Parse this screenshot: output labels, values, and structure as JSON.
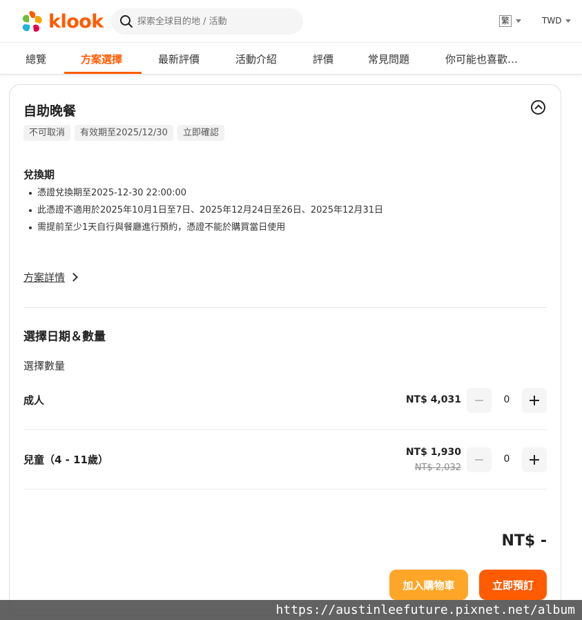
{
  "header": {
    "logo_text": "klook",
    "search_placeholder": "探索全球目的地 / 活動",
    "language": "繁",
    "currency": "TWD"
  },
  "tabs": [
    {
      "label": "總覽"
    },
    {
      "label": "方案選擇"
    },
    {
      "label": "最新評價"
    },
    {
      "label": "活動介紹"
    },
    {
      "label": "評價"
    },
    {
      "label": "常見問題"
    },
    {
      "label": "你可能也喜歡…"
    }
  ],
  "package": {
    "title": "自助晚餐",
    "tags": [
      "不可取消",
      "有效期至2025/12/30",
      "立即確認"
    ],
    "redemption_heading": "兌換期",
    "redemption_items": [
      "憑證兌換期至2025-12-30 22:00:00",
      "此憑證不適用於2025年10月1日至7日、2025年12月24日至26日、2025年12月31日",
      "需提前至少1天自行與餐廳進行預約，憑證不能於購買當日使用"
    ],
    "details_link": "方案詳情"
  },
  "selection": {
    "heading": "選擇日期＆數量",
    "qty_label": "選擇數量",
    "rows": [
      {
        "label": "成人",
        "price": "NT$ 4,031",
        "old_price": "",
        "count": "0"
      },
      {
        "label": "兒童（4 - 11歲）",
        "price": "NT$ 1,930",
        "old_price": "NT$ 2,032",
        "count": "0"
      }
    ]
  },
  "footer": {
    "total": "NT$ -",
    "add_to_cart": "加入購物車",
    "book_now": "立即預訂"
  },
  "watermark": "https://austinleefuture.pixnet.net/album",
  "colors": {
    "brand": "#ff5b00",
    "cart_button": "#ffa628"
  }
}
